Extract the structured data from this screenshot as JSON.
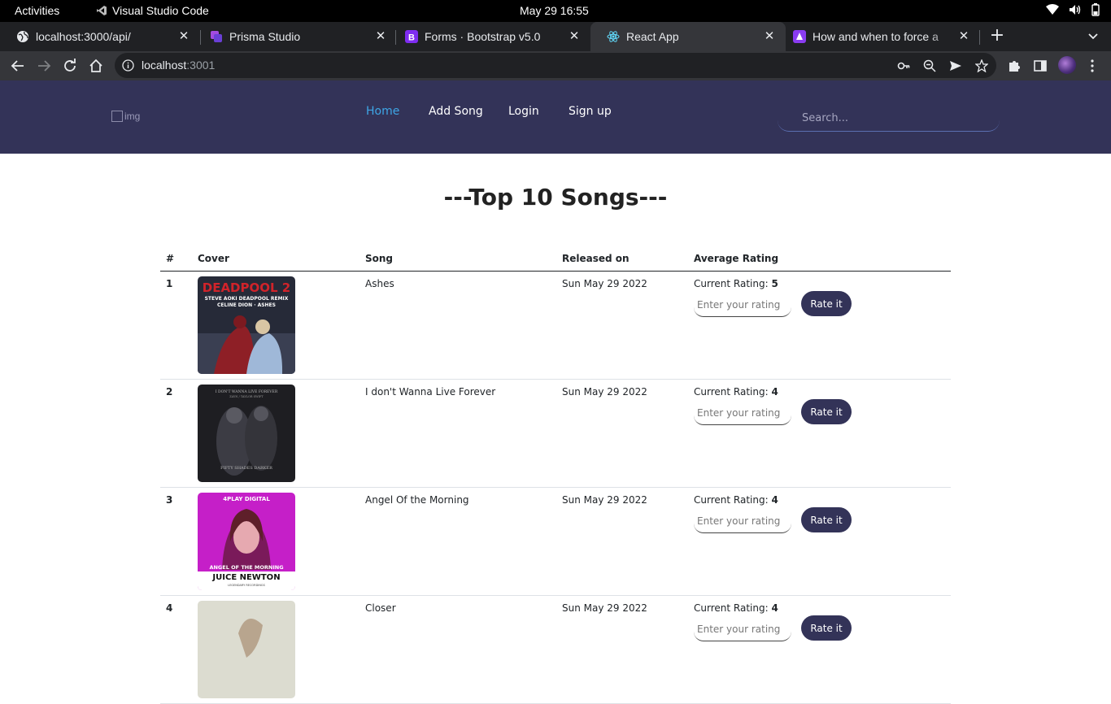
{
  "system_bar": {
    "activities": "Activities",
    "app_name": "Visual Studio Code",
    "clock": "May 29  16:55"
  },
  "browser": {
    "tabs": [
      {
        "title": "localhost:3000/api/",
        "icon": "globe-icon"
      },
      {
        "title": "Prisma Studio",
        "icon": "prisma-icon"
      },
      {
        "title": "Forms · Bootstrap v5.0",
        "icon": "bootstrap-icon"
      },
      {
        "title": "React App",
        "icon": "react-icon"
      },
      {
        "title": "How and when to force a",
        "icon": "stackoverflow-icon"
      }
    ],
    "active_tab": 3,
    "url_host": "localhost",
    "url_port": ":3001"
  },
  "app": {
    "logo_alt": "img",
    "nav": [
      {
        "label": "Home",
        "active": true
      },
      {
        "label": "Add Song",
        "active": false
      },
      {
        "label": "Login",
        "active": false
      },
      {
        "label": "Sign up",
        "active": false
      }
    ],
    "search_placeholder": "Search..."
  },
  "main": {
    "title": "---Top 10 Songs---",
    "columns": [
      "#",
      "Cover",
      "Song",
      "Released on",
      "Average Rating"
    ],
    "rating_prefix": "Current Rating: ",
    "rating_placeholder": "Enter your rating",
    "rate_button": "Rate it",
    "rows": [
      {
        "num": "1",
        "song": "Ashes",
        "released": "Sun May 29 2022",
        "rating": "5",
        "cover_text": [
          "DEADPOOL 2",
          "STEVE AOKI DEADPOOL REMIX",
          "CELINE DION · ASHES"
        ]
      },
      {
        "num": "2",
        "song": "I don't Wanna Live Forever",
        "released": "Sun May 29 2022",
        "rating": "4",
        "cover_text": [
          "I DON'T WANNA LIVE FOREVER",
          "ZAYN / TAYLOR SWIFT",
          "FIFTY SHADES DARKER"
        ]
      },
      {
        "num": "3",
        "song": "Angel Of the Morning",
        "released": "Sun May 29 2022",
        "rating": "4",
        "cover_text": [
          "4PLAY DIGITAL",
          "ANGEL OF THE MORNING",
          "JUICE NEWTON",
          "LEGENDARY RECORDINGS"
        ]
      },
      {
        "num": "4",
        "song": "Closer",
        "released": "Sun May 29 2022",
        "rating": "4",
        "cover_text": []
      }
    ]
  },
  "colors": {
    "navbar": "#333358",
    "nav_active": "#3ea6e6",
    "button": "#333358"
  }
}
